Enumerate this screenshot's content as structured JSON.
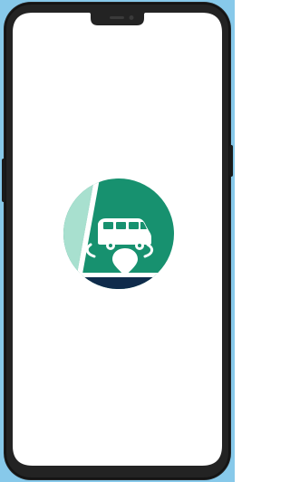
{
  "colors": {
    "page_background": "#87c9ea",
    "phone_body": "#232323",
    "phone_edge": "#141414",
    "screen": "#ffffff",
    "logo_green": "#17916f",
    "logo_mint": "#a8e0cf",
    "logo_navy": "#0f2b4b",
    "logo_white": "#ffffff"
  },
  "icons": {
    "app_logo": "splash-logo-icon",
    "vehicle": "van-icon",
    "location": "location-pin-icon",
    "orbit": "orbit-ring-icon"
  },
  "screen": {
    "state": "splash"
  }
}
